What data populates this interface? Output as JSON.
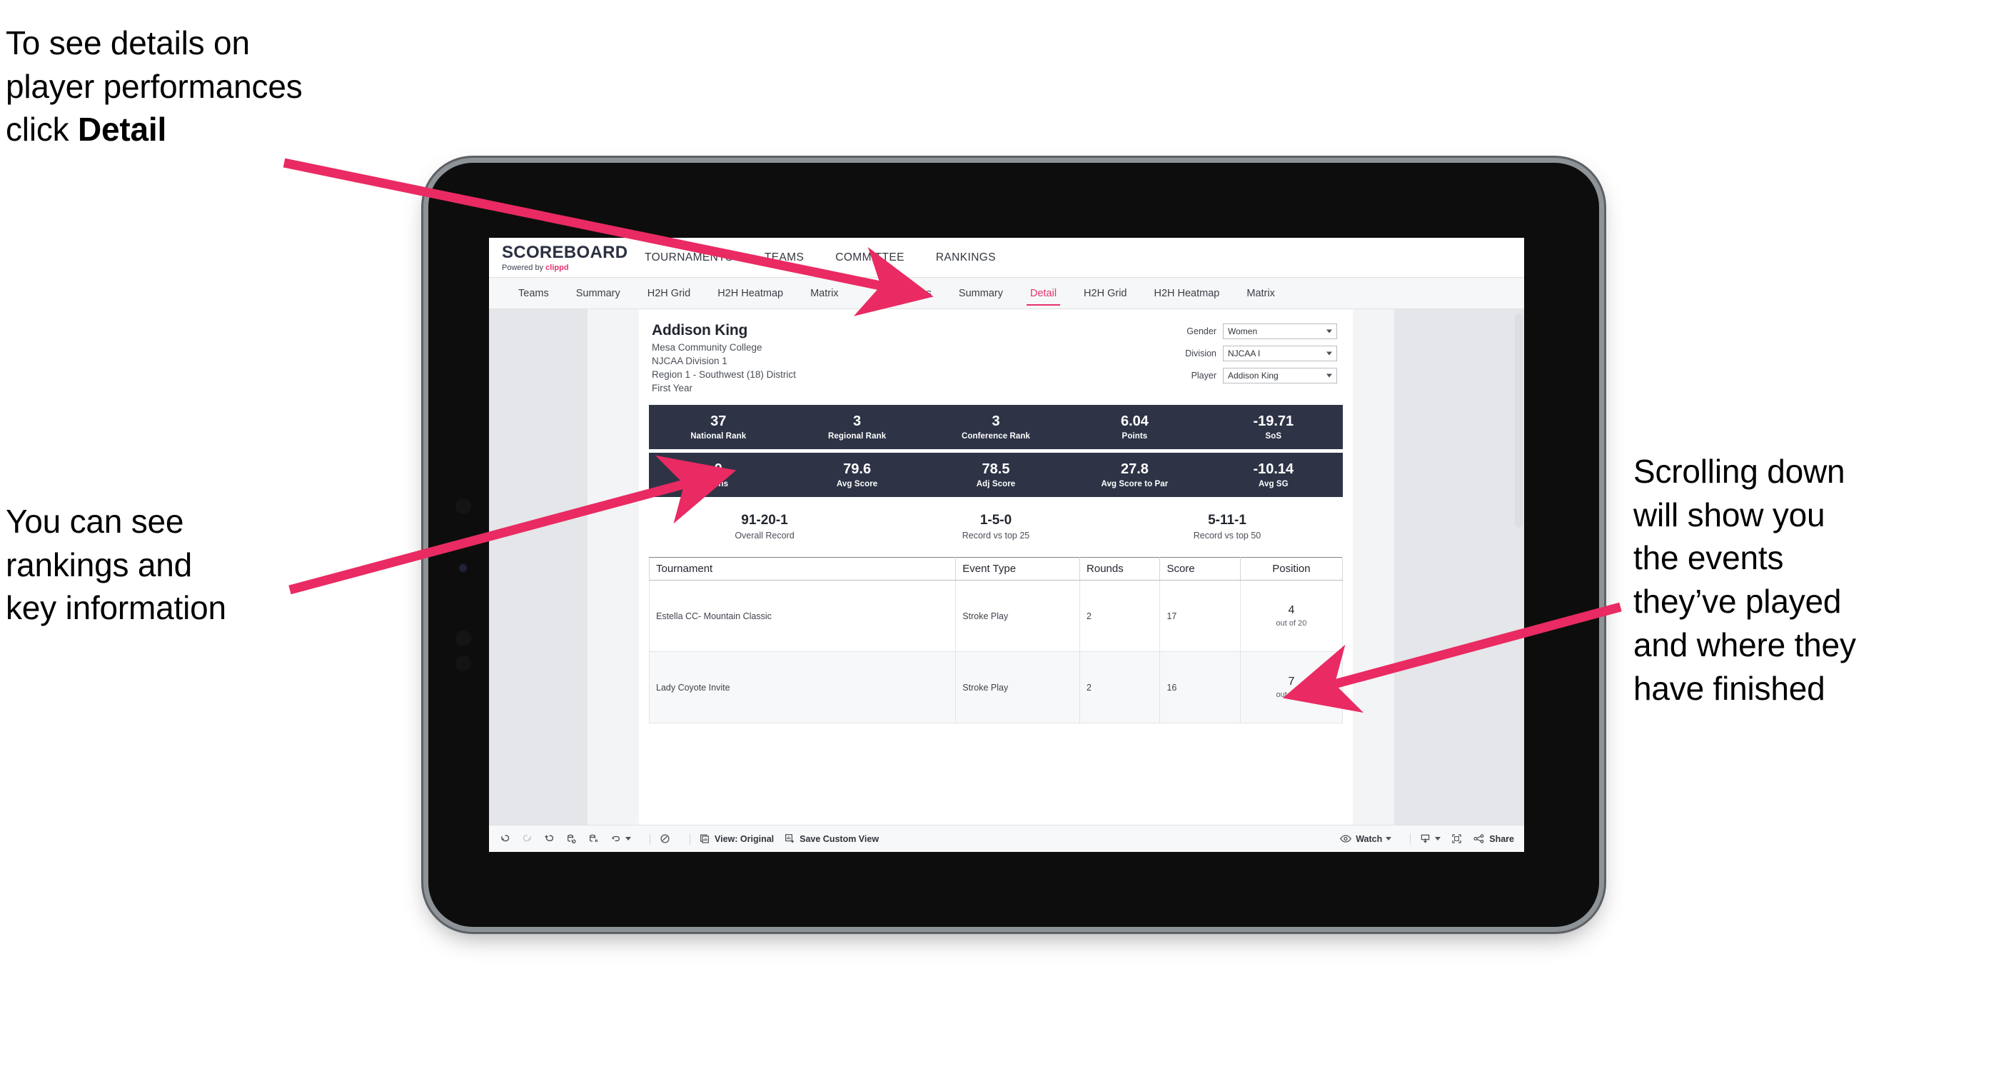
{
  "annotations": {
    "top_left": {
      "line1": "To see details on",
      "line2": "player performances",
      "line3_pre": "click ",
      "line3_bold": "Detail"
    },
    "bottom_left": {
      "line1": "You can see",
      "line2": "rankings and",
      "line3": "key information"
    },
    "right": {
      "line1": "Scrolling down",
      "line2": "will show you",
      "line3": "the events",
      "line4": "they’ve played",
      "line5": "and where they",
      "line6": "have finished"
    },
    "arrow_color": "#ea2a62"
  },
  "app": {
    "brand": {
      "title": "SCOREBOARD",
      "powered_prefix": "Powered by ",
      "powered_accent": "clippd"
    },
    "nav": [
      {
        "label": "TOURNAMENTS"
      },
      {
        "label": "TEAMS"
      },
      {
        "label": "COMMITTEE"
      },
      {
        "label": "RANKINGS"
      }
    ],
    "tabs_left": [
      {
        "label": "Teams",
        "active": false
      },
      {
        "label": "Summary",
        "active": false
      },
      {
        "label": "H2H Grid",
        "active": false
      },
      {
        "label": "H2H Heatmap",
        "active": false
      },
      {
        "label": "Matrix",
        "active": false
      }
    ],
    "tabs_right": [
      {
        "label": "Players",
        "active": false
      },
      {
        "label": "Summary",
        "active": false
      },
      {
        "label": "Detail",
        "active": true
      },
      {
        "label": "H2H Grid",
        "active": false
      },
      {
        "label": "H2H Heatmap",
        "active": false
      },
      {
        "label": "Matrix",
        "active": false
      }
    ]
  },
  "player": {
    "name": "Addison King",
    "college": "Mesa Community College",
    "division": "NJCAA Division 1",
    "region": "Region 1 - Southwest (18) District",
    "year": "First Year"
  },
  "filters": [
    {
      "label": "Gender",
      "value": "Women"
    },
    {
      "label": "Division",
      "value": "NJCAA I"
    },
    {
      "label": "Player",
      "value": "Addison King"
    }
  ],
  "stats_row1": [
    {
      "value": "37",
      "label": "National Rank"
    },
    {
      "value": "3",
      "label": "Regional Rank"
    },
    {
      "value": "3",
      "label": "Conference Rank"
    },
    {
      "value": "6.04",
      "label": "Points"
    },
    {
      "value": "-19.71",
      "label": "SoS"
    }
  ],
  "stats_row2": [
    {
      "value": "0",
      "label": "Wins"
    },
    {
      "value": "79.6",
      "label": "Avg Score"
    },
    {
      "value": "78.5",
      "label": "Adj Score"
    },
    {
      "value": "27.8",
      "label": "Avg Score to Par"
    },
    {
      "value": "-10.14",
      "label": "Avg SG"
    }
  ],
  "records": [
    {
      "value": "91-20-1",
      "label": "Overall Record"
    },
    {
      "value": "1-5-0",
      "label": "Record vs top 25"
    },
    {
      "value": "5-11-1",
      "label": "Record vs top 50"
    }
  ],
  "table": {
    "headers": [
      "Tournament",
      "Event Type",
      "Rounds",
      "Score",
      "Position"
    ],
    "rows": [
      {
        "tournament": "Estella CC- Mountain Classic",
        "event_type": "Stroke Play",
        "rounds": "2",
        "score": "17",
        "position": "4",
        "position_sub": "out of 20"
      },
      {
        "tournament": "Lady Coyote Invite",
        "event_type": "Stroke Play",
        "rounds": "2",
        "score": "16",
        "position": "7",
        "position_sub": "out of 20"
      }
    ]
  },
  "toolbar": {
    "view_label": "View: Original",
    "save_label": "Save Custom View",
    "watch_label": "Watch",
    "share_label": "Share"
  }
}
